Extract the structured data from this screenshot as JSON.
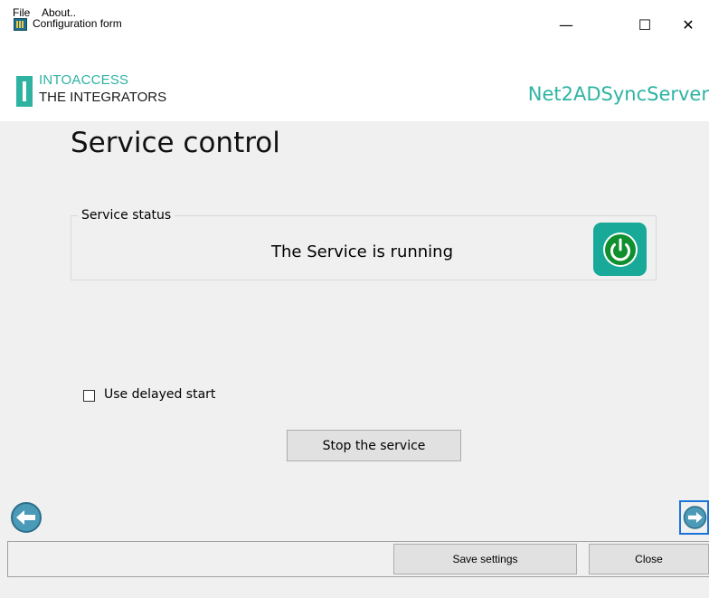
{
  "window": {
    "title": "Configuration form",
    "minimize_glyph": "—",
    "maximize_glyph": "☐",
    "close_glyph": "✕"
  },
  "menu": {
    "items": [
      {
        "label": "File"
      },
      {
        "label": "About.."
      }
    ]
  },
  "banner": {
    "brand_line1": "INTOACCESS",
    "brand_line2": "THE INTEGRATORS",
    "product_name": "Net2ADSyncServer",
    "accent_color": "#2eb3a3"
  },
  "page": {
    "title": "Service control"
  },
  "service_status": {
    "group_label": "Service status",
    "status_text": "The Service is running",
    "indicator_icon": "power-icon",
    "indicator_color": "#18a999"
  },
  "options": {
    "delayed_start_label": "Use delayed start",
    "delayed_start_checked": false
  },
  "actions": {
    "stop_service_label": "Stop the service"
  },
  "navigation": {
    "prev_icon": "arrow-left-icon",
    "next_icon": "arrow-right-icon"
  },
  "footer": {
    "save_label": "Save settings",
    "close_label": "Close"
  }
}
